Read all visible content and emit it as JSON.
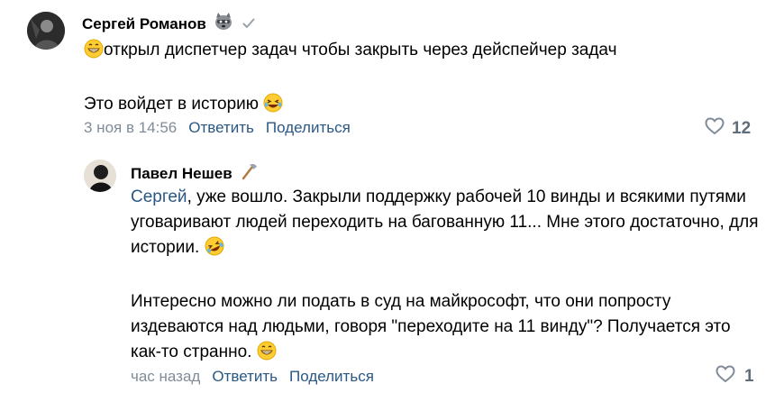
{
  "comments": [
    {
      "author": "Сергей Романов",
      "lines": [
        "открыл диспетчер задач чтобы закрыть через дейспейчер задач",
        "Это войдет в историю"
      ],
      "time": "3 ноя в 14:56",
      "reply_label": "Ответить",
      "share_label": "Поделиться",
      "likes": "12",
      "badge_icon": "raccoon-icon",
      "verified_icon": "checkmark-icon"
    },
    {
      "author": "Павел Нешев",
      "mention": "Сергей",
      "line1_rest": ", уже вошло. Закрыли поддержку рабочей 10 винды и всякими путями уговаривают людей переходить на багованную 11... Мне этого достаточно, для истории.",
      "line2": "Интересно можно ли подать в суд на майкрософт, что они попросту издеваются над людьми, говоря \"переходите на 11 винду\"? Получается это как-то странно.",
      "time": "час назад",
      "reply_label": "Ответить",
      "share_label": "Поделиться",
      "likes": "1",
      "badge_icon": "axe-icon"
    }
  ],
  "colors": {
    "link": "#2a5885",
    "meta": "#818c99",
    "like": "#626d7a"
  }
}
